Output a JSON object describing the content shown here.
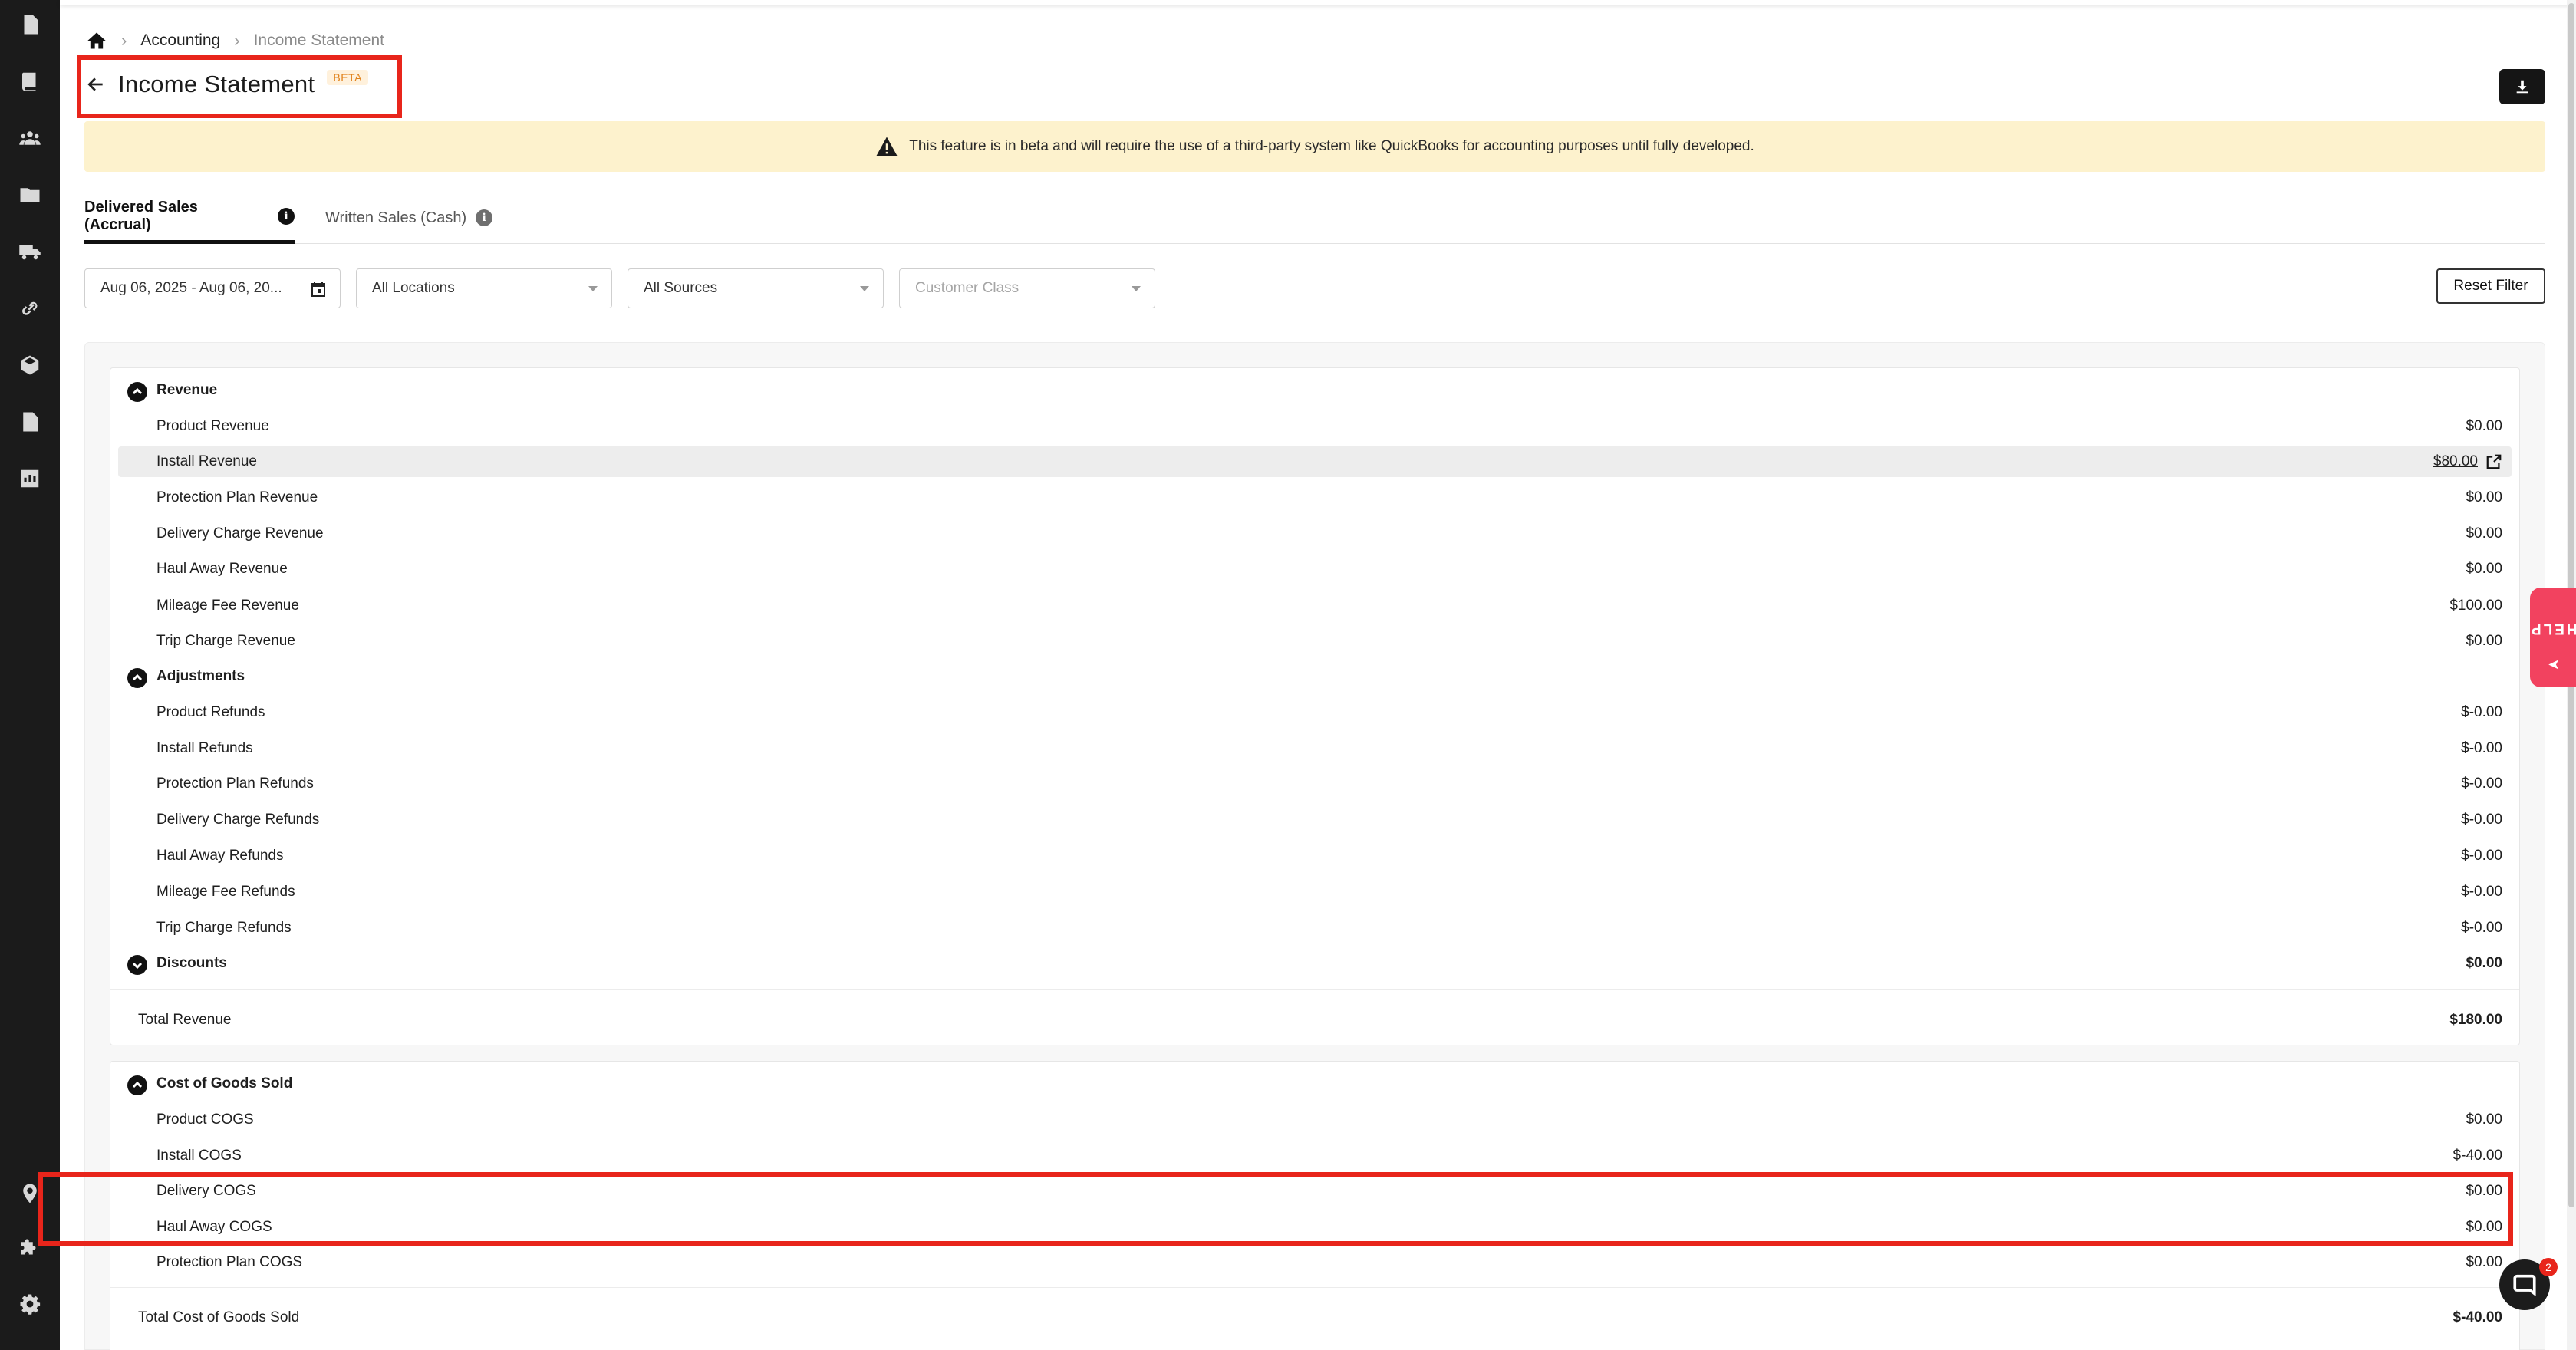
{
  "breadcrumb": {
    "items": [
      "Accounting",
      "Income Statement"
    ]
  },
  "header": {
    "title": "Income Statement",
    "badge": "BETA"
  },
  "banner": {
    "text": "This feature is in beta and will require the use of a third-party system like QuickBooks for accounting purposes until fully developed."
  },
  "tabs": [
    {
      "label": "Delivered Sales (Accrual)",
      "active": true
    },
    {
      "label": "Written Sales (Cash)",
      "active": false
    }
  ],
  "filters": {
    "date_range": "Aug 06, 2025 - Aug 06, 20...",
    "locations": "All Locations",
    "sources": "All Sources",
    "customer_class_placeholder": "Customer Class",
    "reset_label": "Reset Filter"
  },
  "revenue": {
    "title": "Revenue",
    "items": [
      {
        "label": "Product Revenue",
        "value": "$0.00"
      },
      {
        "label": "Install Revenue",
        "value": "$80.00"
      },
      {
        "label": "Protection Plan Revenue",
        "value": "$0.00"
      },
      {
        "label": "Delivery Charge Revenue",
        "value": "$0.00"
      },
      {
        "label": "Haul Away Revenue",
        "value": "$0.00"
      },
      {
        "label": "Mileage Fee Revenue",
        "value": "$100.00"
      },
      {
        "label": "Trip Charge Revenue",
        "value": "$0.00"
      }
    ]
  },
  "adjustments": {
    "title": "Adjustments",
    "items": [
      {
        "label": "Product Refunds",
        "value": "$-0.00"
      },
      {
        "label": "Install Refunds",
        "value": "$-0.00"
      },
      {
        "label": "Protection Plan Refunds",
        "value": "$-0.00"
      },
      {
        "label": "Delivery Charge Refunds",
        "value": "$-0.00"
      },
      {
        "label": "Haul Away Refunds",
        "value": "$-0.00"
      },
      {
        "label": "Mileage Fee Refunds",
        "value": "$-0.00"
      },
      {
        "label": "Trip Charge Refunds",
        "value": "$-0.00"
      }
    ]
  },
  "discounts": {
    "title": "Discounts",
    "value": "$0.00"
  },
  "total_revenue": {
    "label": "Total Revenue",
    "value": "$180.00"
  },
  "cogs": {
    "title": "Cost of Goods Sold",
    "items": [
      {
        "label": "Product COGS",
        "value": "$0.00"
      },
      {
        "label": "Install COGS",
        "value": "$-40.00"
      },
      {
        "label": "Delivery COGS",
        "value": "$0.00"
      },
      {
        "label": "Haul Away COGS",
        "value": "$0.00"
      },
      {
        "label": "Protection Plan COGS",
        "value": "$0.00"
      }
    ]
  },
  "total_cogs": {
    "label": "Total Cost of Goods Sold",
    "value": "$-40.00"
  },
  "help": {
    "label": "HELP"
  },
  "chat": {
    "badge_count": "2"
  },
  "colors": {
    "accent_red": "#e8251b",
    "help_pink": "#f2425f",
    "banner_bg": "#fdf2cd",
    "sidebar_bg": "#1b1b1b"
  },
  "sidebar_icons": [
    "invoice-icon",
    "book-icon",
    "users-icon",
    "folder-icon",
    "truck-icon",
    "link-icon",
    "box-icon",
    "document-icon",
    "chart-icon",
    "location-icon",
    "puzzle-icon",
    "gear-icon"
  ]
}
